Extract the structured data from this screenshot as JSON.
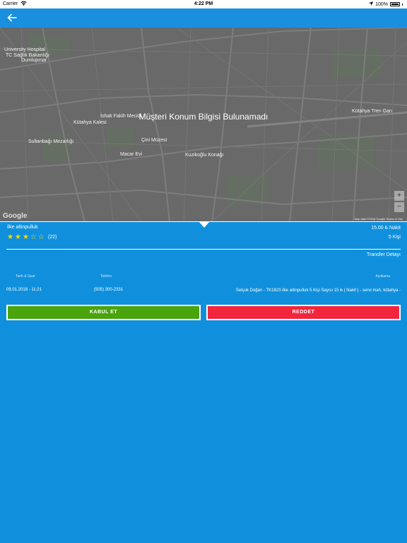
{
  "status_bar": {
    "carrier": "Carrier",
    "time": "4:22 PM",
    "battery": "100%",
    "wifi_icon": "wifi-icon",
    "location_icon": "location-arrow-icon"
  },
  "nav": {
    "back_icon": "back-arrow-icon"
  },
  "map": {
    "message": "Müşteri Konum Bilgisi Bulunamadı",
    "google": "Google",
    "attribution": "Map data ©2018 Google   Terms of Use",
    "zoom_in": "+",
    "zoom_out": "−",
    "labels": {
      "hospital": "University Hospital",
      "hospital2": "TC Sağlık Bakanlığı",
      "hospital3": "Dumlupınar",
      "ishak": "İshak Fakih Mecidi",
      "kutahya_kalesi": "Kütahya Kalesi",
      "sultanbagi": "Sultanbağı Mezarlığı",
      "cini": "Çini Müzesi",
      "macar": "Macar Evi",
      "kuzikoglu": "Kuzikoğlu Konağı",
      "tren": "Kütahya Tren Garı"
    }
  },
  "customer": {
    "location": "ilke altinpulluk",
    "rating": 3,
    "max_rating": 5,
    "review_count": "(22)",
    "price": "15.00 ₺ Nakit",
    "persons": "5 Kişi"
  },
  "transfer": {
    "detail_label": "Transfer Detayı",
    "headers": {
      "date": "Tarih & Saat",
      "phone": "Telefon",
      "desc": "Açıklama"
    },
    "date": "09.01.2018 - 11:21",
    "phone": "(505) 300-2331",
    "description": "Selçuk Doğan - TK1823 ilke altinpulluk 5 Kişi Sayısı 15 ₺ ( Nakit ) - servi mah, kütahya -"
  },
  "actions": {
    "accept": "KABUL ET",
    "reject": "REDDET"
  },
  "colors": {
    "background": "#1090dc",
    "navbar": "#1a8fde",
    "accept": "#4aa40c",
    "reject": "#f2253d",
    "star": "#f5d90a"
  }
}
